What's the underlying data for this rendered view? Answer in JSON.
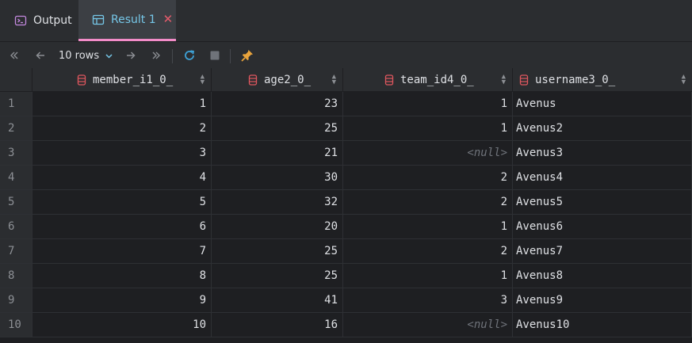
{
  "tabs": [
    {
      "label": "Output",
      "icon": "terminal-icon"
    },
    {
      "label": "Result 1",
      "icon": "table-icon",
      "active": true
    }
  ],
  "toolbar": {
    "rows_label": "10 rows"
  },
  "columns": [
    "member_i1_0_",
    "age2_0_",
    "team_id4_0_",
    "username3_0_"
  ],
  "rows": [
    {
      "n": "1",
      "member": "1",
      "age": "23",
      "team": "1",
      "username": "Avenus"
    },
    {
      "n": "2",
      "member": "2",
      "age": "25",
      "team": "1",
      "username": "Avenus2"
    },
    {
      "n": "3",
      "member": "3",
      "age": "21",
      "team": "<null>",
      "username": "Avenus3"
    },
    {
      "n": "4",
      "member": "4",
      "age": "30",
      "team": "2",
      "username": "Avenus4"
    },
    {
      "n": "5",
      "member": "5",
      "age": "32",
      "team": "2",
      "username": "Avenus5"
    },
    {
      "n": "6",
      "member": "6",
      "age": "20",
      "team": "1",
      "username": "Avenus6"
    },
    {
      "n": "7",
      "member": "7",
      "age": "25",
      "team": "2",
      "username": "Avenus7"
    },
    {
      "n": "8",
      "member": "8",
      "age": "25",
      "team": "1",
      "username": "Avenus8"
    },
    {
      "n": "9",
      "member": "9",
      "age": "41",
      "team": "3",
      "username": "Avenus9"
    },
    {
      "n": "10",
      "member": "10",
      "age": "16",
      "team": "<null>",
      "username": "Avenus10"
    }
  ],
  "colors": {
    "accent_tab_underline": "#f28cc8",
    "active_tab_label": "#76c7e8",
    "close_x": "#e55b6c",
    "column_icon": "#e0575f",
    "refresh_icon": "#3ea3d8",
    "pin_icon": "#e8a33c"
  }
}
